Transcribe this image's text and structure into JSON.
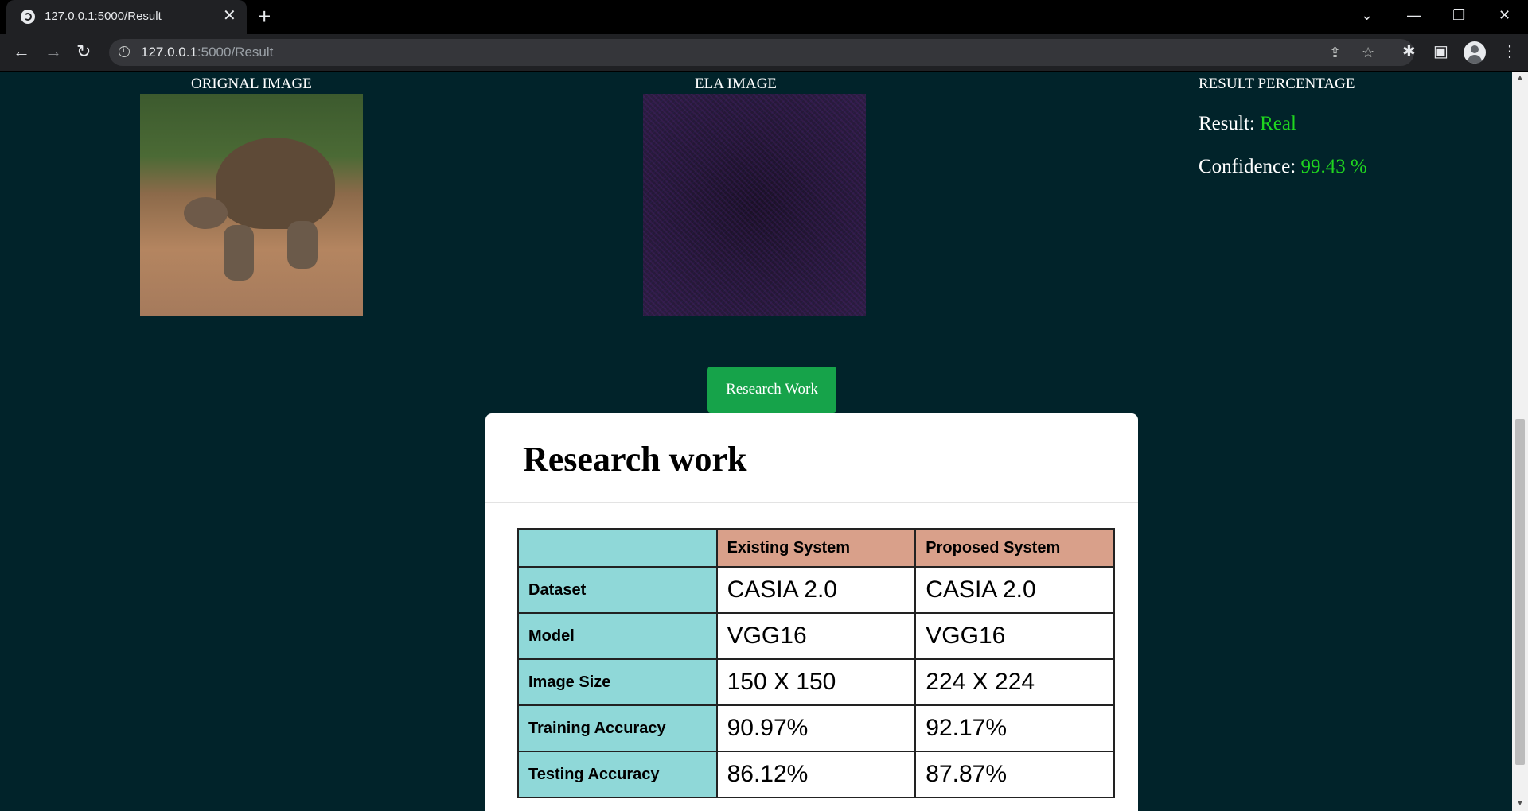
{
  "browser": {
    "tab_title": "127.0.0.1:5000/Result",
    "url_host": "127.0.0.1",
    "url_path": ":5000/Result"
  },
  "page": {
    "original_label": "ORIGNAL IMAGE",
    "ela_label": "ELA IMAGE",
    "result_heading": "RESULT PERCENTAGE",
    "result_label": "Result: ",
    "result_value": "Real",
    "confidence_label": "Confidence: ",
    "confidence_value": "99.43 %",
    "result_color": "#1fd51f",
    "button_label": "Research Work",
    "button_color": "#16a34a"
  },
  "card": {
    "title": "Research work",
    "columns": [
      "",
      "Existing System",
      "Proposed System"
    ],
    "rows": [
      {
        "label": "Dataset",
        "existing": "CASIA 2.0",
        "proposed": "CASIA 2.0"
      },
      {
        "label": "Model",
        "existing": "VGG16",
        "proposed": "VGG16"
      },
      {
        "label": "Image Size",
        "existing": "150 X 150",
        "proposed": "224 X 224"
      },
      {
        "label": "Training Accuracy",
        "existing": "90.97%",
        "proposed": "92.17%"
      },
      {
        "label": "Testing Accuracy",
        "existing": "86.12%",
        "proposed": "87.87%"
      }
    ],
    "header_color": "#d9a08a",
    "label_color": "#8fd8d8"
  },
  "icons": [
    "globe-icon",
    "close-icon",
    "plus-icon",
    "chevron-down-icon",
    "minimize-icon",
    "restore-icon",
    "close-window-icon",
    "back-icon",
    "forward-icon",
    "reload-icon",
    "info-icon",
    "share-icon",
    "star-icon",
    "extensions-icon",
    "side-panel-icon",
    "avatar",
    "more-icon"
  ]
}
